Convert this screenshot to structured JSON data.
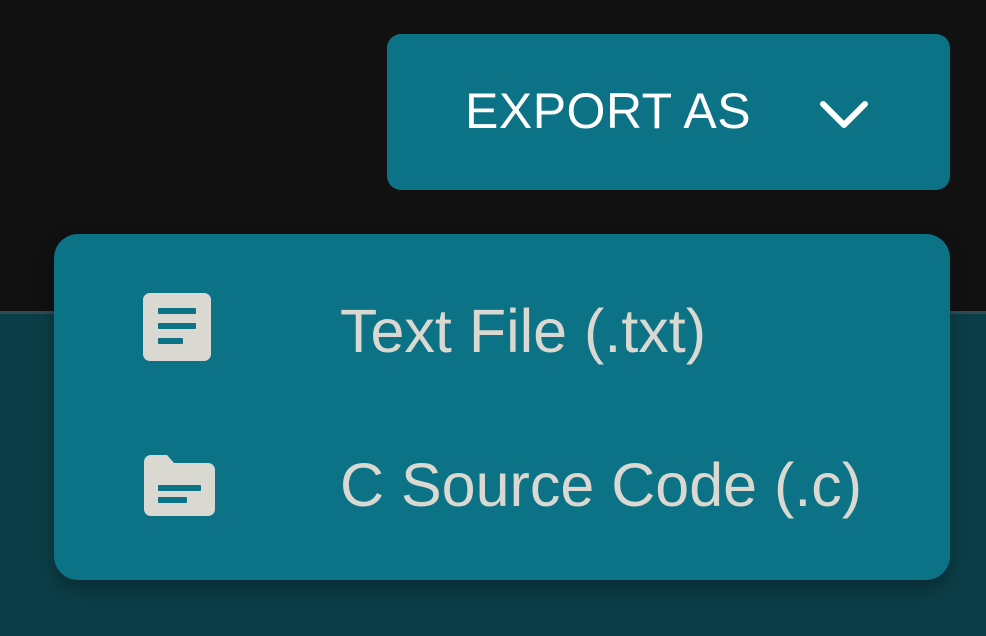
{
  "colors": {
    "background": "#111111",
    "panel": "#0c3e48",
    "accent": "#0c7286",
    "menu_text": "#d9d9d2",
    "button_text": "#ffffff"
  },
  "export_button": {
    "label": "EXPORT AS",
    "icon": "chevron-down-icon"
  },
  "menu": {
    "items": [
      {
        "label": "Text File (.txt)",
        "icon": "text-file-icon"
      },
      {
        "label": "C Source Code (.c)",
        "icon": "source-code-folder-icon"
      }
    ]
  }
}
